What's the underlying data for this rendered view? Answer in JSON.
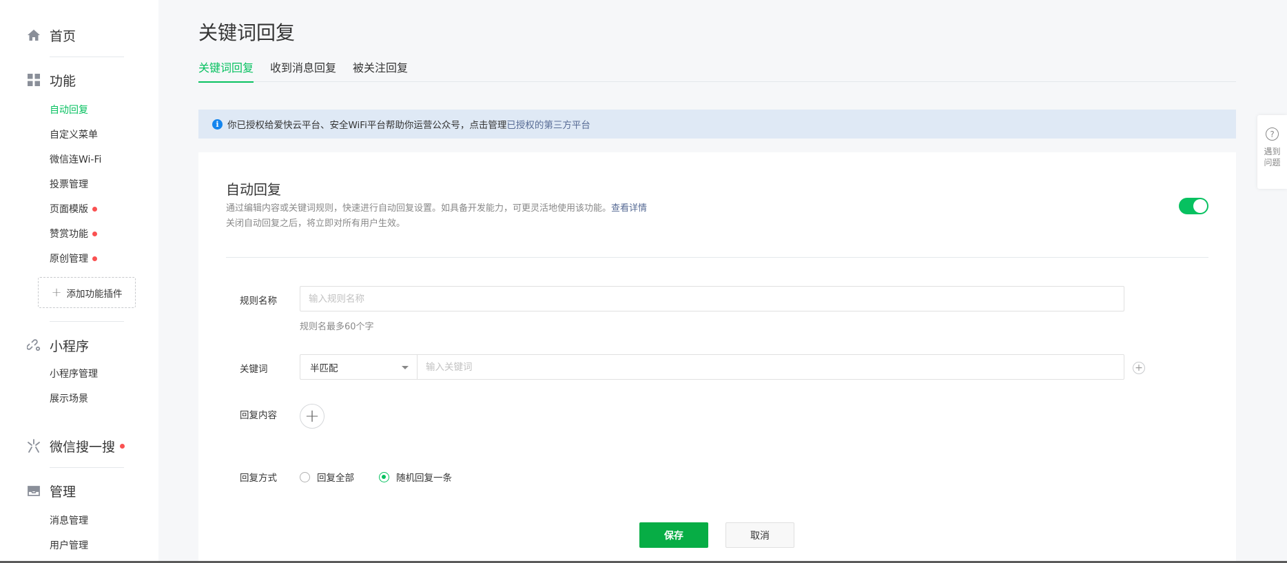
{
  "sidebar": {
    "home": {
      "label": "首页",
      "icon": "home-icon"
    },
    "features": {
      "label": "功能",
      "icon": "grid-icon",
      "items": [
        {
          "label": "自动回复",
          "active": true,
          "dot": false
        },
        {
          "label": "自定义菜单",
          "active": false,
          "dot": false
        },
        {
          "label": "微信连Wi-Fi",
          "active": false,
          "dot": false
        },
        {
          "label": "投票管理",
          "active": false,
          "dot": false
        },
        {
          "label": "页面模版",
          "active": false,
          "dot": true
        },
        {
          "label": "赞赏功能",
          "active": false,
          "dot": true
        },
        {
          "label": "原创管理",
          "active": false,
          "dot": true
        }
      ],
      "add_plugin_label": "添加功能插件"
    },
    "miniprogram": {
      "label": "小程序",
      "icon": "link-icon",
      "items": [
        {
          "label": "小程序管理"
        },
        {
          "label": "展示场景"
        }
      ]
    },
    "search": {
      "label": "微信搜一搜",
      "icon": "search-spark-icon",
      "dot": true
    },
    "manage": {
      "label": "管理",
      "icon": "inbox-icon",
      "items": [
        {
          "label": "消息管理"
        },
        {
          "label": "用户管理"
        }
      ]
    }
  },
  "page": {
    "title": "关键词回复",
    "tabs": [
      {
        "label": "关键词回复",
        "active": true
      },
      {
        "label": "收到消息回复",
        "active": false
      },
      {
        "label": "被关注回复",
        "active": false
      }
    ]
  },
  "notice": {
    "icon": "info-icon",
    "text": "你已授权给爱快云平台、安全WiFi平台帮助你运营公众号，点击管理",
    "link": "已授权的第三方平台"
  },
  "card": {
    "title": "自动回复",
    "desc_line1": "通过编辑内容或关键词规则，快速进行自动回复设置。如具备开发能力，可更灵活地使用该功能。",
    "desc_link": "查看详情",
    "desc_line2": "关闭自动回复之后，将立即对所有用户生效。",
    "toggle_on": true
  },
  "form": {
    "rule_name_label": "规则名称",
    "rule_name_placeholder": "输入规则名称",
    "rule_name_value": "",
    "rule_name_hint": "规则名最多60个字",
    "keyword_label": "关键词",
    "match_type": "半匹配",
    "keyword_placeholder": "输入关键词",
    "keyword_value": "",
    "reply_content_label": "回复内容",
    "reply_mode_label": "回复方式",
    "reply_modes": [
      {
        "label": "回复全部",
        "checked": false
      },
      {
        "label": "随机回复一条",
        "checked": true
      }
    ],
    "save_label": "保存",
    "cancel_label": "取消"
  },
  "help": {
    "icon": "question-icon",
    "text": "遇到问题"
  },
  "colors": {
    "accent": "#07c160",
    "link": "#576b95",
    "dot": "#fa5151",
    "notice_bg": "#dfe9f5"
  }
}
